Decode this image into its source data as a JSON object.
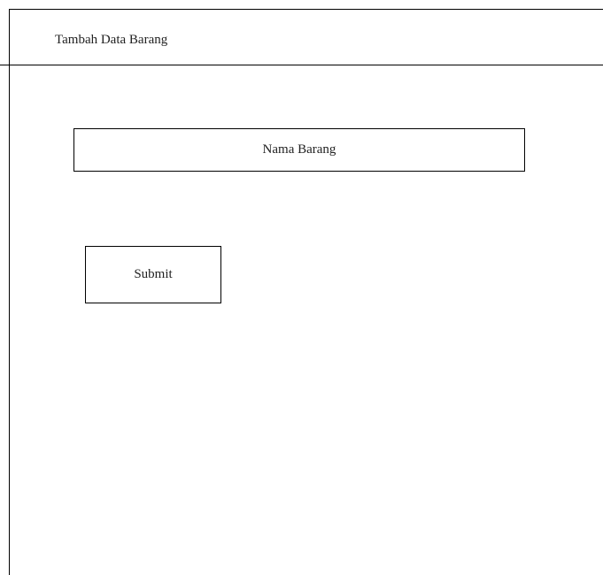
{
  "header": {
    "title": "Tambah Data Barang"
  },
  "form": {
    "name_field_label": "Nama Barang",
    "submit_label": "Submit"
  }
}
